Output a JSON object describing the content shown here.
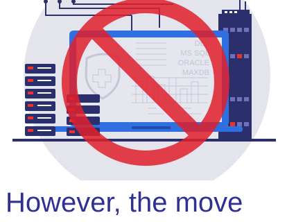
{
  "illustration": {
    "screen_labels": [
      "DB2",
      "MS SQL",
      "ORACLE",
      "MAXDB"
    ],
    "icons": [
      "shield-cross-icon",
      "prohibition-icon"
    ],
    "colors": {
      "navy": "#2b2f6b",
      "laptop_blue": "#2f6fe0",
      "screen_bg": "#e6e6ef",
      "circle_bg": "#e4e4ec",
      "prohibition_red": "#e0202c",
      "accent_red": "#e8322f"
    }
  },
  "caption": {
    "text": "However, the move"
  }
}
